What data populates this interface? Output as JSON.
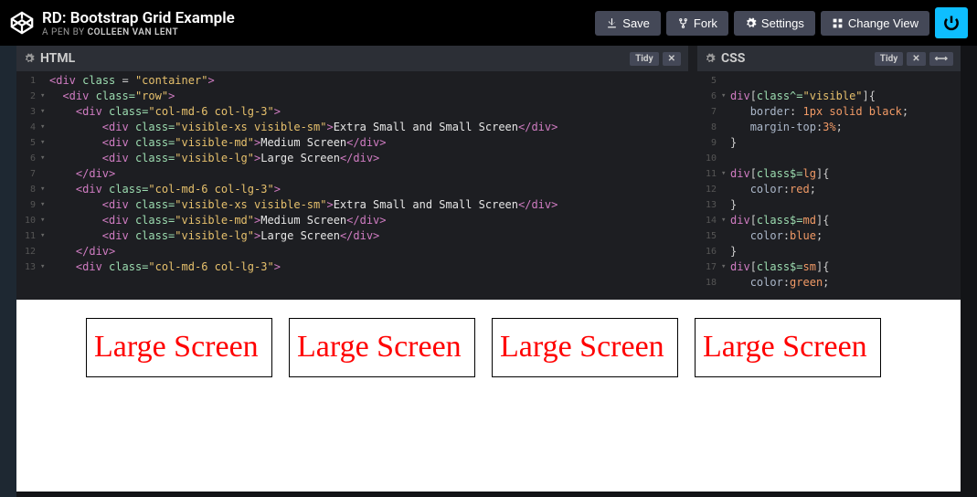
{
  "header": {
    "title": "RD: Bootstrap Grid Example",
    "byline_prefix": "A PEN BY ",
    "author": "Colleen van Lent",
    "buttons": {
      "save": "Save",
      "fork": "Fork",
      "settings": "Settings",
      "change_view": "Change View"
    }
  },
  "panes": {
    "html": {
      "label": "HTML",
      "tidy": "Tidy",
      "lines": [
        {
          "n": "1",
          "f": "",
          "h": "<span class='tag'>&lt;div</span> <span class='attr'>class</span> = <span class='str'>\"container\"</span><span class='tag'>&gt;</span>"
        },
        {
          "n": "2",
          "f": "▾",
          "h": "  <span class='tag'>&lt;div</span> <span class='attr'>class=</span><span class='str'>\"row\"</span><span class='tag'>&gt;</span>"
        },
        {
          "n": "3",
          "f": "▾",
          "h": "    <span class='tag'>&lt;div</span> <span class='attr'>class=</span><span class='str'>\"col-md-6 col-lg-3\"</span><span class='tag'>&gt;</span>"
        },
        {
          "n": "4",
          "f": "▾",
          "h": "        <span class='tag'>&lt;div</span> <span class='attr'>class=</span><span class='str'>\"visible-xs visible-sm\"</span><span class='tag'>&gt;</span><span class='txt'>Extra Small and Small Screen</span><span class='tag'>&lt;/div&gt;</span>"
        },
        {
          "n": "5",
          "f": "▾",
          "h": "        <span class='tag'>&lt;div</span> <span class='attr'>class=</span><span class='str'>\"visible-md\"</span><span class='tag'>&gt;</span><span class='txt'>Medium Screen</span><span class='tag'>&lt;/div&gt;</span>"
        },
        {
          "n": "6",
          "f": "▾",
          "h": "        <span class='tag'>&lt;div</span> <span class='attr'>class=</span><span class='str'>\"visible-lg\"</span><span class='tag'>&gt;</span><span class='txt'>Large Screen</span><span class='tag'>&lt;/div&gt;</span>"
        },
        {
          "n": "7",
          "f": "",
          "h": "    <span class='tag'>&lt;/div&gt;</span>"
        },
        {
          "n": "8",
          "f": "▾",
          "h": "    <span class='tag'>&lt;div</span> <span class='attr'>class=</span><span class='str'>\"col-md-6 col-lg-3\"</span><span class='tag'>&gt;</span>"
        },
        {
          "n": "9",
          "f": "▾",
          "h": "        <span class='tag'>&lt;div</span> <span class='attr'>class=</span><span class='str'>\"visible-xs visible-sm\"</span><span class='tag'>&gt;</span><span class='txt'>Extra Small and Small Screen</span><span class='tag'>&lt;/div&gt;</span>"
        },
        {
          "n": "10",
          "f": "▾",
          "h": "        <span class='tag'>&lt;div</span> <span class='attr'>class=</span><span class='str'>\"visible-md\"</span><span class='tag'>&gt;</span><span class='txt'>Medium Screen</span><span class='tag'>&lt;/div&gt;</span>"
        },
        {
          "n": "11",
          "f": "▾",
          "h": "        <span class='tag'>&lt;div</span> <span class='attr'>class=</span><span class='str'>\"visible-lg\"</span><span class='tag'>&gt;</span><span class='txt'>Large Screen</span><span class='tag'>&lt;/div&gt;</span>"
        },
        {
          "n": "12",
          "f": "",
          "h": "    <span class='tag'>&lt;/div&gt;</span>"
        },
        {
          "n": "13",
          "f": "▾",
          "h": "    <span class='tag'>&lt;div</span> <span class='attr'>class=</span><span class='str'>\"col-md-6 col-lg-3\"</span><span class='tag'>&gt;</span>"
        }
      ]
    },
    "css": {
      "label": "CSS",
      "tidy": "Tidy",
      "lines": [
        {
          "n": "5",
          "f": "",
          "h": ""
        },
        {
          "n": "6",
          "f": "▾",
          "h": "<span class='kw'>div</span>[<span class='attr'>class^=</span><span class='str'>\"visible\"</span>]<span class='brace'>{</span>"
        },
        {
          "n": "7",
          "f": "",
          "h": "   <span class='prop'>border</span>: <span class='num'>1px</span> <span class='val'>solid black</span>;"
        },
        {
          "n": "8",
          "f": "",
          "h": "   <span class='prop'>margin-top</span>:<span class='num'>3%</span>;"
        },
        {
          "n": "9",
          "f": "",
          "h": "<span class='brace'>}</span>"
        },
        {
          "n": "10",
          "f": "",
          "h": ""
        },
        {
          "n": "11",
          "f": "▾",
          "h": "<span class='kw'>div</span>[<span class='attr'>class$=</span><span class='val'>lg</span>]<span class='brace'>{</span>"
        },
        {
          "n": "12",
          "f": "",
          "h": "   <span class='prop'>color</span>:<span class='val'>red</span>;"
        },
        {
          "n": "13",
          "f": "",
          "h": "<span class='brace'>}</span>"
        },
        {
          "n": "14",
          "f": "▾",
          "h": "<span class='kw'>div</span>[<span class='attr'>class$=</span><span class='val'>md</span>]<span class='brace'>{</span>"
        },
        {
          "n": "15",
          "f": "",
          "h": "   <span class='prop'>color</span>:<span class='val'>blue</span>;"
        },
        {
          "n": "16",
          "f": "",
          "h": "<span class='brace'>}</span>"
        },
        {
          "n": "17",
          "f": "▾",
          "h": "<span class='kw'>div</span>[<span class='attr'>class$=</span><span class='val'>sm</span>]<span class='brace'>{</span>"
        },
        {
          "n": "18",
          "f": "",
          "h": "   <span class='prop'>color</span>:<span class='val'>green</span>;"
        }
      ]
    }
  },
  "preview": {
    "cards": [
      "Large Screen",
      "Large Screen",
      "Large Screen",
      "Large Screen"
    ]
  }
}
